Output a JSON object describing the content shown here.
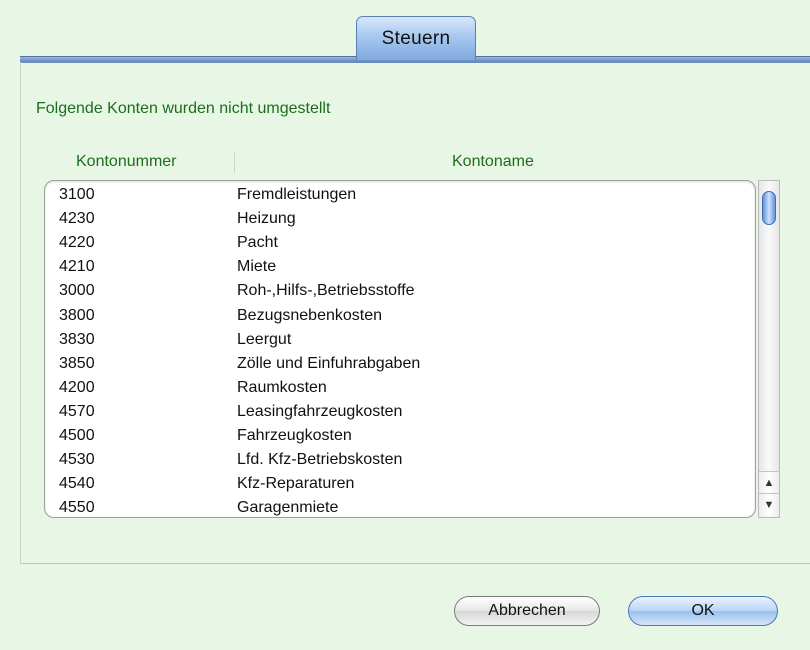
{
  "tab": {
    "label": "Steuern"
  },
  "message": "Folgende Konten wurden nicht umgestellt",
  "table": {
    "headers": {
      "number": "Kontonummer",
      "name": "Kontoname"
    },
    "rows": [
      {
        "number": "3100",
        "name": "Fremdleistungen"
      },
      {
        "number": "4230",
        "name": "Heizung"
      },
      {
        "number": "4220",
        "name": "Pacht"
      },
      {
        "number": "4210",
        "name": "Miete"
      },
      {
        "number": "3000",
        "name": "Roh-,Hilfs-,Betriebsstoffe"
      },
      {
        "number": "3800",
        "name": "Bezugsnebenkosten"
      },
      {
        "number": "3830",
        "name": "Leergut"
      },
      {
        "number": "3850",
        "name": "Zölle und Einfuhrabgaben"
      },
      {
        "number": "4200",
        "name": "Raumkosten"
      },
      {
        "number": "4570",
        "name": "Leasingfahrzeugkosten"
      },
      {
        "number": "4500",
        "name": "Fahrzeugkosten"
      },
      {
        "number": "4530",
        "name": "Lfd. Kfz-Betriebskosten"
      },
      {
        "number": "4540",
        "name": "Kfz-Reparaturen"
      },
      {
        "number": "4550",
        "name": "Garagenmiete"
      }
    ]
  },
  "scrollbar": {
    "up_icon": "arrow-up-icon",
    "down_icon": "arrow-down-icon",
    "up_glyph": "▲",
    "down_glyph": "▼"
  },
  "buttons": {
    "cancel_label": "Abbrechen",
    "ok_label": "OK"
  },
  "colors": {
    "background": "#e8f6e6",
    "accent_green": "#1c6e1c",
    "tab_blue": "#7fa9df"
  }
}
